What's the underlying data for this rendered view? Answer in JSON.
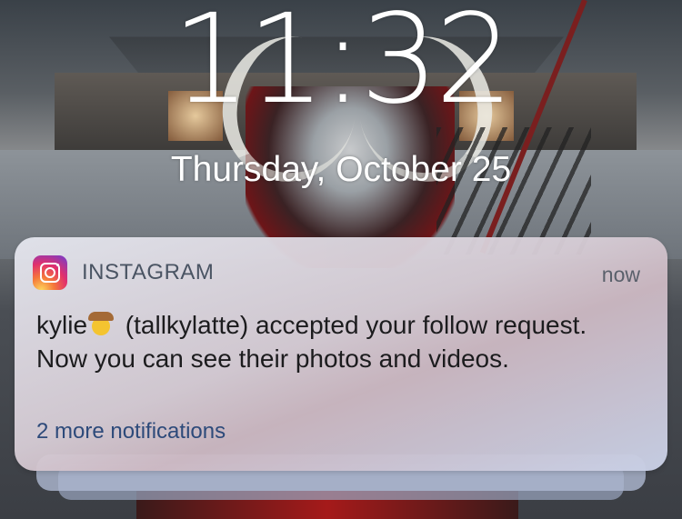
{
  "lockscreen": {
    "time": "11:32",
    "date": "Thursday, October 25"
  },
  "notification": {
    "app_icon": "instagram-icon",
    "app_name": "INSTAGRAM",
    "timestamp": "now",
    "username": "kylie",
    "emoji": "cowboy-face-emoji",
    "message": " (tallkylatte) accepted your follow request. Now you can see their photos and videos.",
    "more_label": "2 more notifications"
  },
  "colors": {
    "app_name": "#4a5463",
    "more_link": "#2d4a7a",
    "instagram_gradient": [
      "#fdd55b",
      "#f5783a",
      "#e1306c",
      "#8a3ab9"
    ]
  }
}
